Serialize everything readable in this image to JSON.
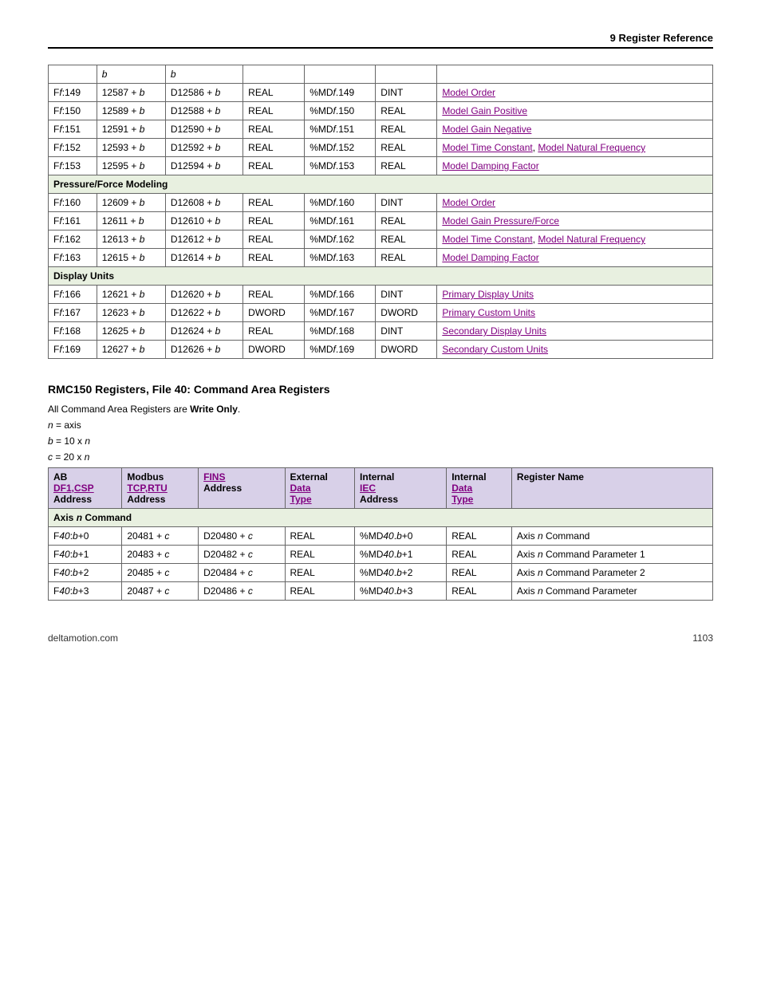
{
  "header": "9  Register Reference",
  "t1": {
    "r0": {
      "c1": "b",
      "c2": "b"
    },
    "rows": [
      {
        "c0": "Ff:149",
        "c1": "12587 + b",
        "c2": "D12586 + b",
        "c3": "REAL",
        "c4": "%MDf.149",
        "c5": "DINT",
        "c6": "Model Order"
      },
      {
        "c0": "Ff:150",
        "c1": "12589 + b",
        "c2": "D12588 + b",
        "c3": "REAL",
        "c4": "%MDf.150",
        "c5": "REAL",
        "c6": "Model Gain Positive"
      },
      {
        "c0": "Ff:151",
        "c1": "12591 + b",
        "c2": "D12590 + b",
        "c3": "REAL",
        "c4": "%MDf.151",
        "c5": "REAL",
        "c6": "Model Gain Negative"
      },
      {
        "c0": "Ff:152",
        "c1": "12593 + b",
        "c2": "D12592 + b",
        "c3": "REAL",
        "c4": "%MDf.152",
        "c5": "REAL",
        "c6a": "Model Time Constant",
        "c6b": "Model Natural Frequency"
      },
      {
        "c0": "Ff:153",
        "c1": "12595 + b",
        "c2": "D12594 + b",
        "c3": "REAL",
        "c4": "%MDf.153",
        "c5": "REAL",
        "c6": "Model Damping Factor"
      }
    ],
    "s1": "Pressure/Force Modeling",
    "rows2": [
      {
        "c0": "Ff:160",
        "c1": "12609 + b",
        "c2": "D12608 + b",
        "c3": "REAL",
        "c4": "%MDf.160",
        "c5": "DINT",
        "c6": "Model Order"
      },
      {
        "c0": "Ff:161",
        "c1": "12611 + b",
        "c2": "D12610 + b",
        "c3": "REAL",
        "c4": "%MDf.161",
        "c5": "REAL",
        "c6": "Model Gain Pressure/Force"
      },
      {
        "c0": "Ff:162",
        "c1": "12613 + b",
        "c2": "D12612 + b",
        "c3": "REAL",
        "c4": "%MDf.162",
        "c5": "REAL",
        "c6a": "Model Time Constant",
        "c6b": "Model Natural Frequency"
      },
      {
        "c0": "Ff:163",
        "c1": "12615 + b",
        "c2": "D12614 + b",
        "c3": "REAL",
        "c4": "%MDf.163",
        "c5": "REAL",
        "c6": "Model Damping Factor"
      }
    ],
    "s2": "Display Units",
    "rows3": [
      {
        "c0": "Ff:166",
        "c1": "12621 + b",
        "c2": "D12620 + b",
        "c3": "REAL",
        "c4": "%MDf.166",
        "c5": "DINT",
        "c6": "Primary Display Units"
      },
      {
        "c0": "Ff:167",
        "c1": "12623 + b",
        "c2": "D12622 + b",
        "c3": "DWORD",
        "c4": "%MDf.167",
        "c5": "DWORD",
        "c6": "Primary Custom Units"
      },
      {
        "c0": "Ff:168",
        "c1": "12625 + b",
        "c2": "D12624 + b",
        "c3": "REAL",
        "c4": "%MDf.168",
        "c5": "DINT",
        "c6": "Secondary Display Units"
      },
      {
        "c0": "Ff:169",
        "c1": "12627 + b",
        "c2": "D12626 + b",
        "c3": "DWORD",
        "c4": "%MDf.169",
        "c5": "DWORD",
        "c6": "Secondary Custom Units"
      }
    ]
  },
  "h3": "RMC150 Registers, File 40: Command Area Registers",
  "p1a": "All Command Area Registers are ",
  "p1b": "Write Only",
  "p1c": ".",
  "p2": "n = axis",
  "p3": "b = 10 x n",
  "p4": "c = 20 x n",
  "t2": {
    "h": {
      "c0a": "AB",
      "c0b": "DF1,CSP",
      "c0c": "Address",
      "c1a": "Modbus",
      "c1b": "TCP,RTU",
      "c1c": "Address",
      "c2a": "FINS",
      "c2b": "Address",
      "c3a": "External",
      "c3b": "Data",
      "c3c": "Type",
      "c4a": "Internal",
      "c4b": "IEC",
      "c4c": "Address",
      "c5a": "Internal",
      "c5b": "Data",
      "c5c": "Type",
      "c6": "Register Name"
    },
    "s": "Axis n Command",
    "rows": [
      {
        "c0": "F40:b+0",
        "c1": "20481 + c",
        "c2": "D20480 + c",
        "c3": "REAL",
        "c4": "%MD40.b+0",
        "c5": "REAL",
        "c6": "Axis n Command"
      },
      {
        "c0": "F40:b+1",
        "c1": "20483 + c",
        "c2": "D20482 + c",
        "c3": "REAL",
        "c4": "%MD40.b+1",
        "c5": "REAL",
        "c6": "Axis n Command Parameter 1"
      },
      {
        "c0": "F40:b+2",
        "c1": "20485 + c",
        "c2": "D20484 + c",
        "c3": "REAL",
        "c4": "%MD40.b+2",
        "c5": "REAL",
        "c6": "Axis n Command Parameter 2"
      },
      {
        "c0": "F40:b+3",
        "c1": "20487 + c",
        "c2": "D20486 + c",
        "c3": "REAL",
        "c4": "%MD40.b+3",
        "c5": "REAL",
        "c6": "Axis n Command Parameter"
      }
    ]
  },
  "ftr": {
    "l": "deltamotion.com",
    "r": "1103"
  }
}
